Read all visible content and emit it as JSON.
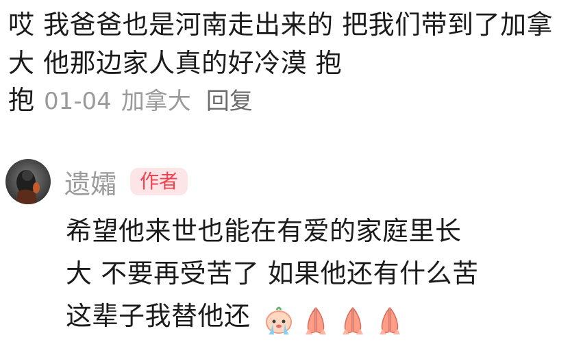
{
  "comment": {
    "text": "哎 我爸爸也是河南走出来的 把我们带到了加拿大 他那边家人真的好冷漠 抱",
    "tail": "抱",
    "date": "01-04",
    "location": "加拿大",
    "reply_label": "回复"
  },
  "reply": {
    "username": "遗孀",
    "badge": "作者",
    "text_line1": "希望他来世也能在有爱的家庭里长",
    "text_line2": "大 不要再受苦了 如果他还有什么苦",
    "text_line3": "这辈子我替他还",
    "emojis": [
      "crying-face-emoji",
      "praying-hands-emoji",
      "praying-hands-emoji",
      "praying-hands-emoji"
    ]
  },
  "colors": {
    "text": "#1b1b1b",
    "meta": "#9a9a9a",
    "reply": "#6b6b6b",
    "badge_bg": "#fde4e6",
    "badge_text": "#f0424f"
  }
}
